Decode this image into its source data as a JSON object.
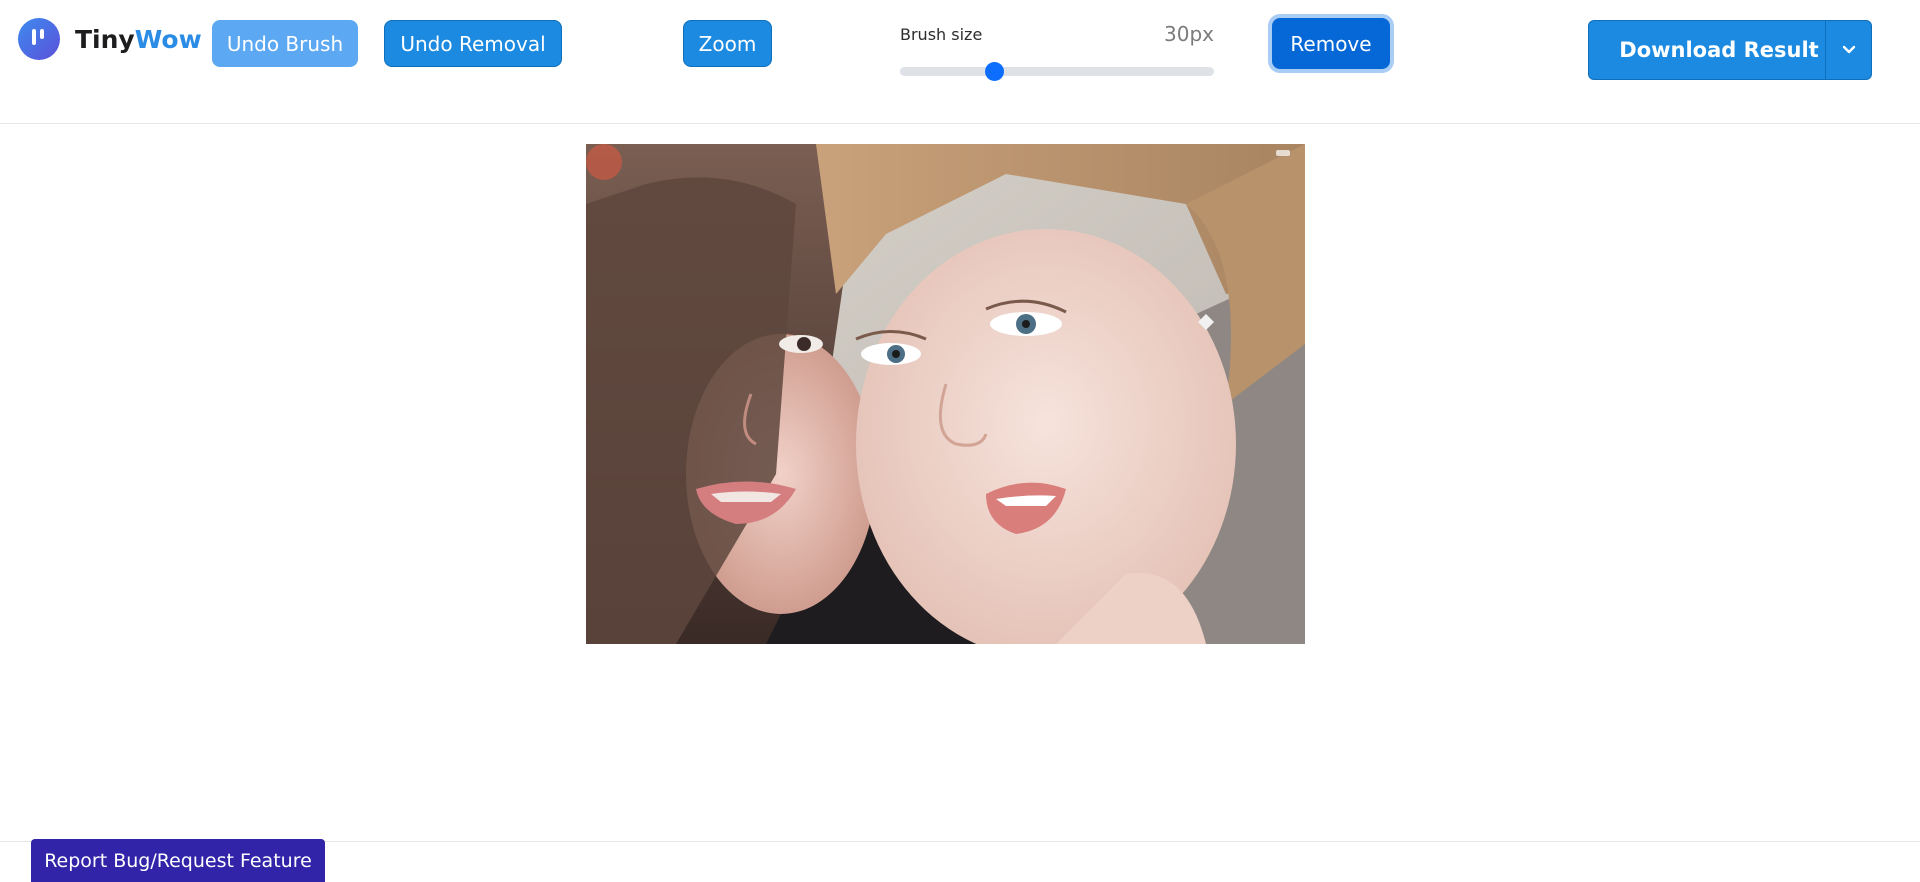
{
  "app": {
    "logo_part1": "Tiny",
    "logo_part2": "Wow",
    "logo_icon": "tinywow-logo-icon"
  },
  "toolbar": {
    "undo_brush_label": "Undo Brush",
    "undo_removal_label": "Undo Removal",
    "zoom_label": "Zoom",
    "brush_size_label": "Brush size",
    "brush_size_value": "30px",
    "brush_slider_fraction": 0.3,
    "remove_label": "Remove",
    "download_label": "Download Result",
    "download_menu_icon": "chevron-down-icon"
  },
  "canvas": {
    "content": "photo-editing-canvas"
  },
  "footer": {
    "report_label": "Report Bug/Request Feature"
  },
  "colors": {
    "primary_button": "#1b8ae0",
    "disabled_button": "#5ca8f2",
    "active_button": "#0668d6",
    "slider_thumb": "#0d6efd",
    "report_button": "#3124a8",
    "logo_blue": "#2b8ce6"
  }
}
